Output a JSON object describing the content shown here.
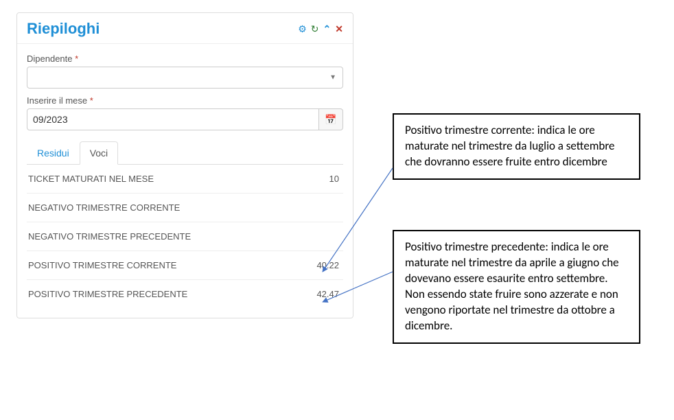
{
  "panel": {
    "title": "Riepiloghi",
    "icons": {
      "settings": "⚙",
      "refresh": "↻",
      "collapse": "⌃",
      "close": "✕"
    }
  },
  "form": {
    "dipendente_label": "Dipendente",
    "dipendente_value": "",
    "mese_label": "Inserire il mese",
    "mese_value": "09/2023",
    "required_mark": "*"
  },
  "tabs": {
    "residui": "Residui",
    "voci": "Voci"
  },
  "rows": [
    {
      "label": "TICKET MATURATI NEL MESE",
      "value": "10"
    },
    {
      "label": "NEGATIVO TRIMESTRE CORRENTE",
      "value": ""
    },
    {
      "label": "NEGATIVO TRIMESTRE PRECEDENTE",
      "value": ""
    },
    {
      "label": "POSITIVO TRIMESTRE CORRENTE",
      "value": "40.22"
    },
    {
      "label": "POSITIVO TRIMESTRE PRECEDENTE",
      "value": "42.47"
    }
  ],
  "callouts": {
    "corrente": "Positivo trimestre corrente: indica le ore maturate nel trimestre da luglio a settembre che dovranno essere fruite entro dicembre",
    "precedente": "Positivo trimestre precedente: indica le ore maturate nel trimestre da aprile a giugno che dovevano essere esaurite entro settembre. Non essendo state fruire sono azzerate e non vengono riportate nel trimestre da ottobre a dicembre."
  },
  "colors": {
    "accent_blue": "#1f8fd6",
    "arrow": "#4472c4"
  }
}
